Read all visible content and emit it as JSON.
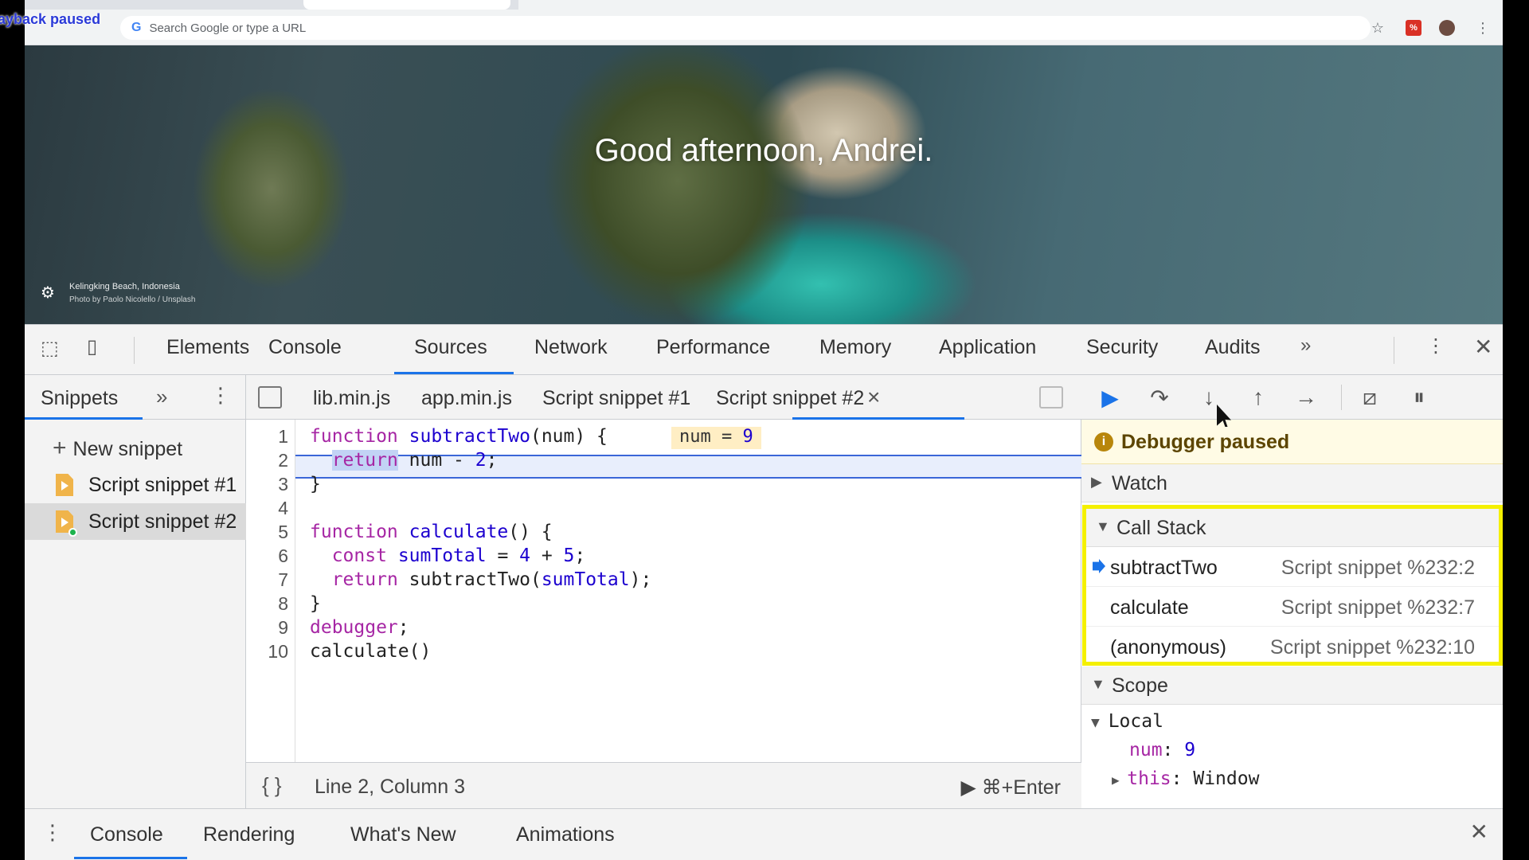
{
  "overlay": {
    "playback": "Playback paused"
  },
  "browser": {
    "omnibox_placeholder": "Search Google or type a URL",
    "star_icon": "star-icon",
    "extension_label": "%",
    "menu_icon": "⋮"
  },
  "page": {
    "greeting": "Good afternoon, Andrei.",
    "photo_location": "Kelingking Beach, Indonesia",
    "photo_credit": "Photo by Paolo Nicolello / Unsplash"
  },
  "devtools": {
    "tabs": [
      "Elements",
      "Console",
      "Sources",
      "Network",
      "Performance",
      "Memory",
      "Application",
      "Security",
      "Audits"
    ],
    "active_tab": "Sources",
    "navigator": {
      "tab": "Snippets",
      "new_snippet": "New snippet",
      "items": [
        "Script snippet #1",
        "Script snippet #2"
      ],
      "selected_index": 1
    },
    "editor": {
      "tabs": [
        "lib.min.js",
        "app.min.js",
        "Script snippet #1",
        "Script snippet #2"
      ],
      "active_tab": "Script snippet #2",
      "close_icon": "×",
      "lines": [
        "function subtractTwo(num) {",
        "  return num - 2;",
        "}",
        "",
        "function calculate() {",
        "  const sumTotal = 4 + 5;",
        "  return subtractTwo(sumTotal);",
        "}",
        "debugger;",
        "calculate()"
      ],
      "inline_value": {
        "name": "num",
        "eq": " = ",
        "value": "9"
      },
      "status_position": "Line 2, Column 3",
      "run_shortcut": "⌘+Enter",
      "format_icon": "{ }"
    },
    "debugger": {
      "paused_message": "Debugger paused",
      "sections": {
        "watch": "Watch",
        "call_stack": "Call Stack",
        "scope": "Scope"
      },
      "call_stack": [
        {
          "function": "subtractTwo",
          "location": "Script snippet %232:2",
          "current": true
        },
        {
          "function": "calculate",
          "location": "Script snippet %232:7",
          "current": false
        },
        {
          "function": "(anonymous)",
          "location": "Script snippet %232:10",
          "current": false
        }
      ],
      "scope": {
        "local_label": "Local",
        "num_key": "num",
        "num_value": "9",
        "this_key": "this",
        "this_value": "Window"
      },
      "highlight_color": "#f4f000"
    },
    "drawer": {
      "tabs": [
        "Console",
        "Rendering",
        "What's New",
        "Animations"
      ],
      "active_tab": "Console"
    }
  },
  "accent_color": "#1a73e8"
}
